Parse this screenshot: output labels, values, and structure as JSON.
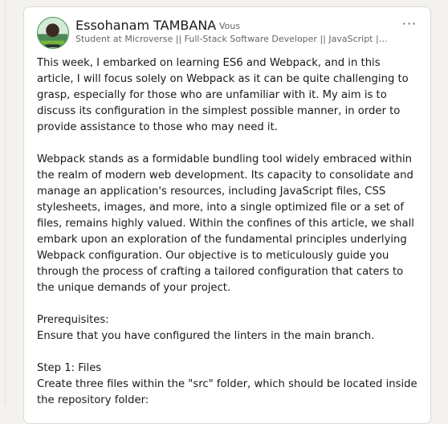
{
  "post": {
    "author": {
      "name": "Essohanam TAMBANA",
      "relation": "• Vous",
      "headline": "Student at Microverse || Full-Stack Software Developer || JavaScript || …",
      "avatar_icon": "profile-photo-icon"
    },
    "more_icon": "more-horizontal-icon",
    "more_label": "···",
    "paragraphs": {
      "p1": "This week, I embarked on learning ES6 and Webpack, and in this article, I will focus solely on Webpack as it can be quite challenging to grasp, especially for those who are unfamiliar with it. My aim is to discuss its configuration in the simplest possible manner, in order to provide assistance to those who may need it.",
      "p2": "Webpack stands as a formidable bundling tool widely embraced within the realm of modern web development. Its capacity to consolidate and manage an application's resources, including JavaScript files, CSS stylesheets, images, and more, into a single optimized file or a set of files, remains highly valued. Within the confines of this article, we shall embark upon an exploration of the fundamental principles underlying Webpack configuration. Our objective is to meticulously guide you through the process of crafting a tailored configuration that caters to the unique demands of your project.",
      "prereq_title": "Prerequisites:",
      "prereq_text": "Ensure that you have configured the linters in the main branch.",
      "step1_title": "Step 1: Files",
      "step1_text": "Create three files within the \"src\" folder, which should be located inside the repository folder:"
    }
  }
}
